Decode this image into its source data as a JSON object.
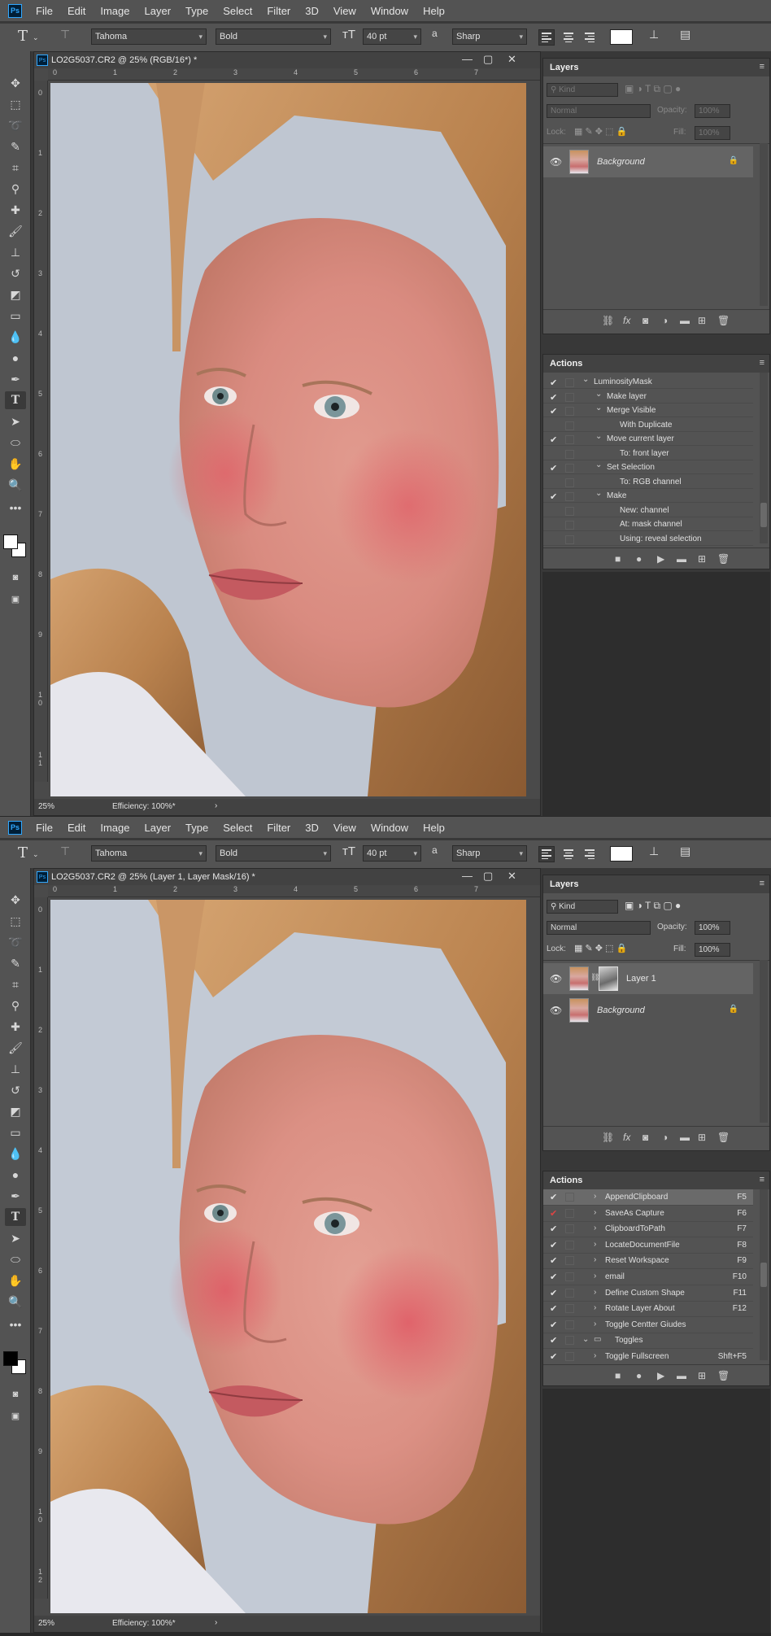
{
  "menu": [
    "File",
    "Edit",
    "Image",
    "Layer",
    "Type",
    "Select",
    "Filter",
    "3D",
    "View",
    "Window",
    "Help"
  ],
  "ps_logo": "Ps",
  "options": {
    "font_family": "Tahoma",
    "font_style": "Bold",
    "font_size": "40 pt",
    "aa_label": "a",
    "antialias": "Sharp"
  },
  "icons": {
    "type_tool": "type-tool-icon",
    "eye": "eye-icon",
    "lock": "lock-icon"
  },
  "screen1": {
    "doc_title": "LO2G5037.CR2 @ 25% (RGB/16*) *",
    "zoom": "25%",
    "efficiency": "Efficiency: 100%*",
    "layers": {
      "title": "Layers",
      "kind": "Kind",
      "blend": "Normal",
      "opacity_label": "Opacity:",
      "opacity": "100%",
      "lock_label": "Lock:",
      "fill_label": "Fill:",
      "fill": "100%",
      "items": [
        {
          "name": "Background"
        }
      ]
    },
    "actions": {
      "title": "Actions",
      "rows": [
        {
          "check": "✔",
          "label": "LuminosityMask",
          "twirl": "⌄",
          "indent": 1
        },
        {
          "check": "✔",
          "label": "Make layer",
          "twirl": "⌄",
          "indent": 2
        },
        {
          "check": "✔",
          "label": "Merge Visible",
          "twirl": "⌄",
          "indent": 2
        },
        {
          "check": "",
          "label": "With Duplicate",
          "twirl": "",
          "indent": 3
        },
        {
          "check": "✔",
          "label": "Move current layer",
          "twirl": "⌄",
          "indent": 2
        },
        {
          "check": "",
          "label": "To: front layer",
          "twirl": "",
          "indent": 3
        },
        {
          "check": "✔",
          "label": "Set Selection",
          "twirl": "⌄",
          "indent": 2
        },
        {
          "check": "",
          "label": "To: RGB channel",
          "twirl": "",
          "indent": 3
        },
        {
          "check": "✔",
          "label": "Make",
          "twirl": "⌄",
          "indent": 2
        },
        {
          "check": "",
          "label": "New: channel",
          "twirl": "",
          "indent": 3
        },
        {
          "check": "",
          "label": "At: mask channel",
          "twirl": "",
          "indent": 3
        },
        {
          "check": "",
          "label": "Using: reveal selection",
          "twirl": "",
          "indent": 3
        }
      ]
    }
  },
  "screen2": {
    "doc_title": "LO2G5037.CR2 @ 25% (Layer 1, Layer Mask/16) *",
    "zoom": "25%",
    "efficiency": "Efficiency: 100%*",
    "layers": {
      "title": "Layers",
      "kind": "Kind",
      "blend": "Normal",
      "opacity_label": "Opacity:",
      "opacity": "100%",
      "lock_label": "Lock:",
      "fill_label": "Fill:",
      "fill": "100%",
      "items": [
        {
          "name": "Layer 1"
        },
        {
          "name": "Background"
        }
      ]
    },
    "actions": {
      "title": "Actions",
      "rows": [
        {
          "check": "✔",
          "label": "AppendClipboard",
          "key": "F5"
        },
        {
          "check": "✔",
          "label": "SaveAs Capture",
          "key": "F6",
          "red": true
        },
        {
          "check": "✔",
          "label": "ClipboardToPath",
          "key": "F7"
        },
        {
          "check": "✔",
          "label": "LocateDocumentFile",
          "key": "F8"
        },
        {
          "check": "✔",
          "label": "Reset Workspace",
          "key": "F9"
        },
        {
          "check": "✔",
          "label": "email",
          "key": "F10"
        },
        {
          "check": "✔",
          "label": "Define Custom Shape",
          "key": "F11"
        },
        {
          "check": "✔",
          "label": "Rotate Layer About",
          "key": "F12"
        },
        {
          "check": "✔",
          "label": "Toggle Centter Giudes",
          "key": ""
        },
        {
          "check": "✔",
          "label": "Toggles",
          "key": "",
          "folder": true
        },
        {
          "check": "✔",
          "label": "Toggle Fullscreen",
          "key": "Shft+F5"
        }
      ]
    }
  },
  "ruler_h": [
    "0",
    "1",
    "2",
    "3",
    "4",
    "5",
    "6",
    "7"
  ],
  "ruler_v": [
    "0",
    "1",
    "2",
    "3",
    "4",
    "5",
    "6",
    "7",
    "8",
    "9",
    "1 0",
    "1 1",
    "1 2"
  ]
}
